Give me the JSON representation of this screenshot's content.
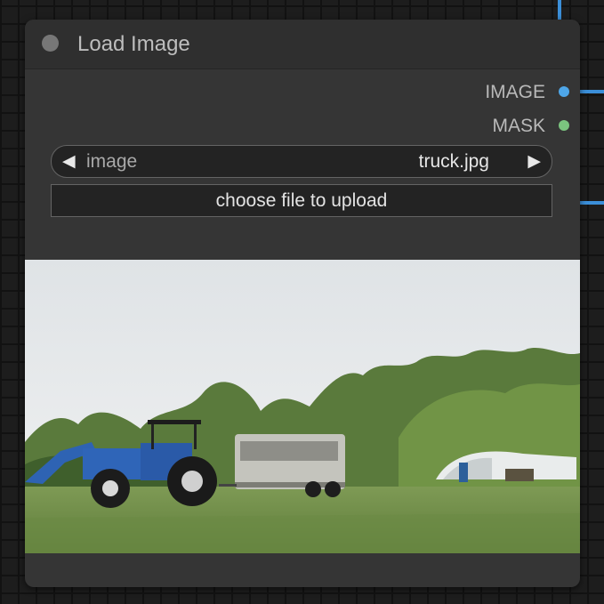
{
  "node": {
    "title": "Load Image",
    "outputs": [
      {
        "label": "IMAGE",
        "color": "#4ea6e8"
      },
      {
        "label": "MASK",
        "color": "#7bc47f"
      }
    ],
    "image_widget": {
      "label": "image",
      "value": "truck.jpg",
      "prev_icon": "◀",
      "next_icon": "▶"
    },
    "upload_button": {
      "label": "choose file to upload"
    }
  },
  "colors": {
    "node_bg": "#353535",
    "title_bg": "#2f2f2f",
    "link": "#3b8fd9",
    "widget_bg": "#232323"
  },
  "icons": [
    "status-dot-icon",
    "image-output-dot-icon",
    "mask-output-dot-icon",
    "arrow-left-icon",
    "arrow-right-icon"
  ]
}
